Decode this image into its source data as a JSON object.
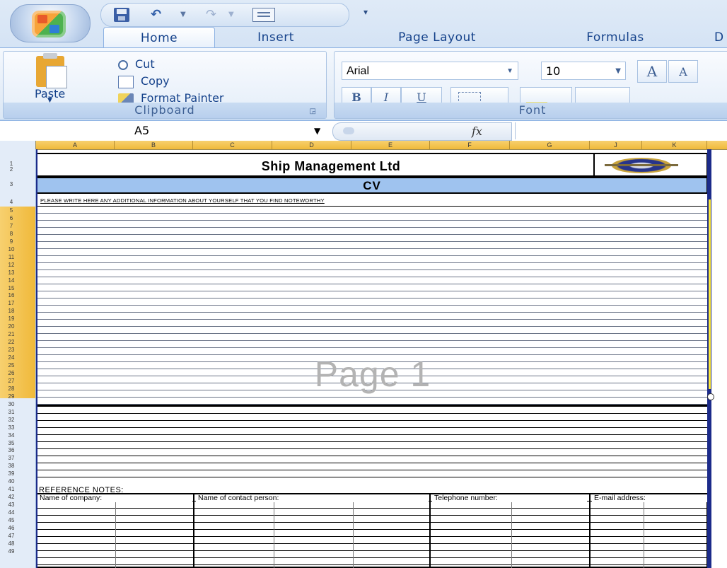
{
  "quick_access": {
    "customize_glyph": "▾"
  },
  "tabs": [
    "Home",
    "Insert",
    "Page Layout",
    "Formulas",
    "D"
  ],
  "clipboard": {
    "paste_label": "Paste",
    "cut_label": "Cut",
    "copy_label": "Copy",
    "format_painter_label": "Format Painter",
    "group_title": "Clipboard"
  },
  "font": {
    "name": "Arial",
    "size": "10",
    "group_title": "Font",
    "bold_glyph": "B",
    "italic_glyph": "I",
    "underline_glyph": "U",
    "grow_glyph": "A",
    "shrink_glyph": "A"
  },
  "formula_bar": {
    "name_box": "A5",
    "fx_label": "fx",
    "formula": ""
  },
  "columns": [
    "A",
    "B",
    "C",
    "D",
    "E",
    "F",
    "G",
    "J",
    "K"
  ],
  "rows": [
    "1",
    "2",
    "3",
    "4",
    "5",
    "6",
    "7",
    "8",
    "9",
    "10",
    "11",
    "12",
    "13",
    "14",
    "15",
    "16",
    "17",
    "18",
    "19",
    "20",
    "21",
    "22",
    "23",
    "24",
    "25",
    "26",
    "27",
    "28",
    "29",
    "30",
    "31",
    "32",
    "33",
    "34",
    "35",
    "36",
    "37",
    "38",
    "39",
    "40",
    "41",
    "42",
    "43",
    "44",
    "45",
    "46",
    "47",
    "48",
    "49"
  ],
  "document": {
    "company_title": "Ship Management Ltd",
    "section_title": "CV",
    "instruction": "PLEASE WRITE HERE ANY ADDITIONAL INFORMATION ABOUT YOURSELF THAT YOU FIND NOTEWORTHY",
    "watermark": "Page 1",
    "reference_label": "REFERENCE NOTES:",
    "reference_headers": [
      "Name of company:",
      "Name of contact person:",
      "Telephone number:",
      "E-mail address:"
    ]
  },
  "colors": {
    "ribbon_text": "#15428b",
    "cv_bar": "#9fc3ef",
    "selection_header": "#f0b93a",
    "sheet_border": "#1c2b8a"
  }
}
